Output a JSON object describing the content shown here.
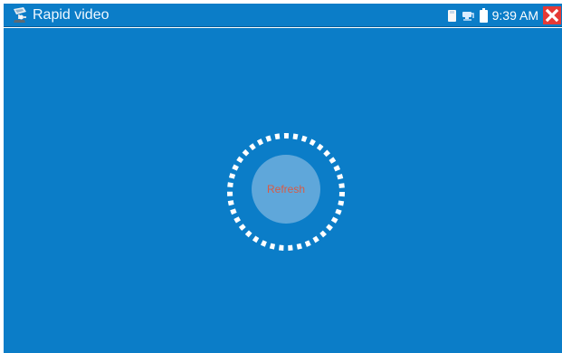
{
  "status_bar": {
    "app_icon": "camera-icon",
    "title": "Rapid video",
    "time": "9:39 AM",
    "icons": {
      "storage": "sd-card-icon",
      "network": "network-icon",
      "battery": "battery-icon",
      "close": "close-icon"
    }
  },
  "main": {
    "refresh_label": "Refresh"
  },
  "colors": {
    "primary_background": "#0b7dc8",
    "refresh_circle": "#5fa7da",
    "refresh_text": "#d85b45",
    "close_red": "#e53935",
    "ring_white": "#ffffff"
  }
}
